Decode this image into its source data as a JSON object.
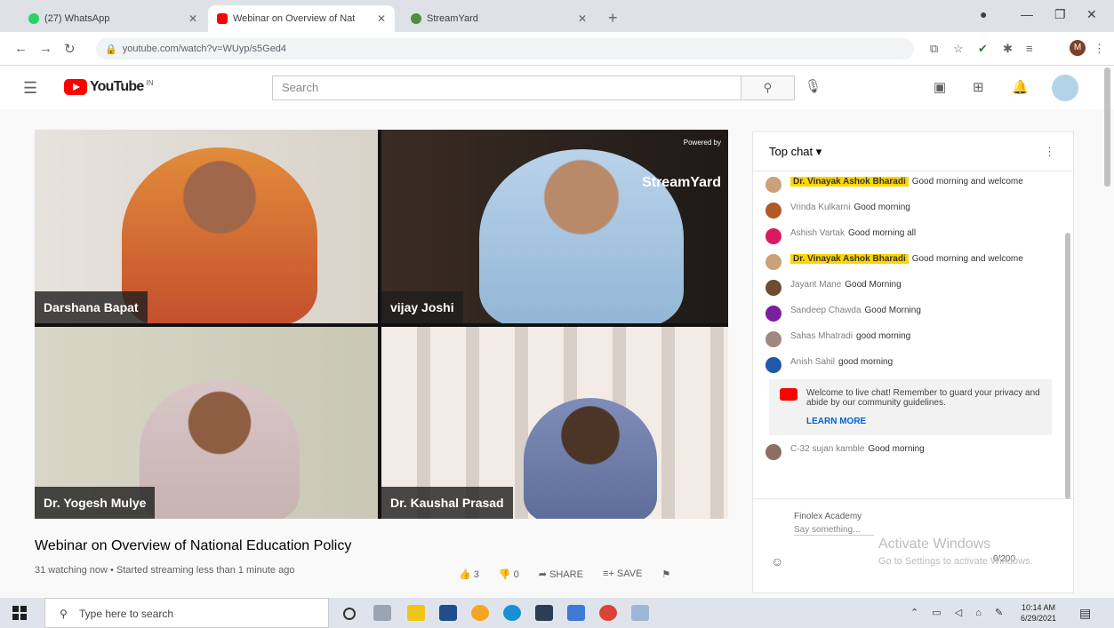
{
  "browser": {
    "tabs": [
      {
        "title": "(27) WhatsApp",
        "color": "#25d366"
      },
      {
        "title": "Webinar on Overview of Nat",
        "color": "#ff0000"
      },
      {
        "title": "StreamYard",
        "color": "#4d8f3e"
      }
    ],
    "new_tab": "+",
    "url": "youtube.com/watch?v=WUyp/s5Ged4",
    "profile_initial": "M"
  },
  "youtube": {
    "logo_word": "YouTube",
    "logo_region": "IN",
    "search_placeholder": "Search"
  },
  "video": {
    "powered_small": "Powered by",
    "powered_brand": "StreamYard",
    "participants": [
      {
        "name": "Darshana Bapat"
      },
      {
        "name": "vijay Joshi"
      },
      {
        "name": "Dr. Yogesh Mulye"
      },
      {
        "name": "Dr. Kaushal Prasad"
      }
    ],
    "title": "Webinar on Overview of National Education Policy",
    "meta": "31 watching now • Started streaming less than 1 minute ago",
    "likes": "3",
    "dislikes": "0",
    "share": "SHARE",
    "save": "SAVE"
  },
  "chat": {
    "header": "Top chat ▾",
    "messages": [
      {
        "author": "Dr. Vinayak Ashok Bharadi",
        "text": "Good morning and welcome",
        "owner": true,
        "color": "#c9a27a"
      },
      {
        "author": "Vrinda Kulkarni",
        "text": "Good morning",
        "owner": false,
        "color": "#b05a2a"
      },
      {
        "author": "Ashish Vartak",
        "text": "Good morning all",
        "owner": false,
        "color": "#d81b60"
      },
      {
        "author": "Dr. Vinayak Ashok Bharadi",
        "text": "Good morning and welcome",
        "owner": true,
        "color": "#c9a27a"
      },
      {
        "author": "Jayant Mane",
        "text": "Good Morning",
        "owner": false,
        "color": "#6d4c2f"
      },
      {
        "author": "Sandeep Chawda",
        "text": "Good Morning",
        "owner": false,
        "color": "#7b1fa2"
      },
      {
        "author": "Sahas Mhatradi",
        "text": "good morning",
        "owner": false,
        "color": "#a1887f"
      },
      {
        "author": "Anish Sahil",
        "text": "good morning",
        "owner": false,
        "color": "#1e5aa8"
      }
    ],
    "notice_text": "Welcome to live chat! Remember to guard your privacy and abide by our community guidelines.",
    "notice_link": "LEARN MORE",
    "last_message": {
      "author": "C-32 sujan kamble",
      "text": "Good morning",
      "color": "#8d6e63"
    },
    "footer_name": "Finolex Academy",
    "footer_placeholder": "Say something...",
    "char_count": "0/200"
  },
  "watermark": {
    "line1": "Activate Windows",
    "line2": "Go to Settings to activate Windows."
  },
  "taskbar": {
    "search_text": "Type here to search",
    "time": "10:14 AM",
    "date": "6/29/2021"
  }
}
